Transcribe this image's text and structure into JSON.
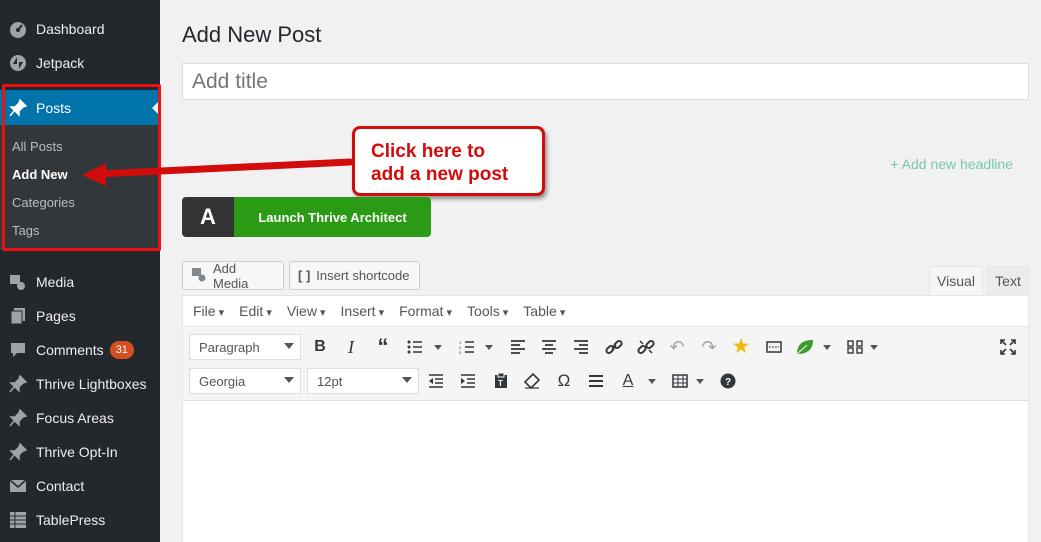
{
  "sidebar": {
    "items_top": [
      {
        "label": "Dashboard",
        "icon": "dashboard-icon"
      },
      {
        "label": "Jetpack",
        "icon": "jetpack-icon"
      }
    ],
    "posts": {
      "label": "Posts",
      "icon": "pin-icon"
    },
    "submenu": [
      {
        "label": "All Posts"
      },
      {
        "label": "Add New"
      },
      {
        "label": "Categories"
      },
      {
        "label": "Tags"
      }
    ],
    "items_bottom": [
      {
        "label": "Media",
        "icon": "media-icon"
      },
      {
        "label": "Pages",
        "icon": "pages-icon"
      },
      {
        "label": "Comments",
        "icon": "comments-icon",
        "badge": "31"
      },
      {
        "label": "Thrive Lightboxes",
        "icon": "pin-icon"
      },
      {
        "label": "Focus Areas",
        "icon": "pin-icon"
      },
      {
        "label": "Thrive Opt-In",
        "icon": "pin-icon"
      },
      {
        "label": "Contact",
        "icon": "mail-icon"
      },
      {
        "label": "TablePress",
        "icon": "table-icon"
      }
    ]
  },
  "main": {
    "page_title": "Add New Post",
    "title_placeholder": "Add title",
    "add_headline": "+ Add new headline",
    "callout_line1": "Click here to",
    "callout_line2": "add a new post",
    "thrive_logo": "A",
    "thrive_button": "Launch Thrive Architect",
    "add_media": "Add Media",
    "insert_shortcode": "Insert shortcode",
    "tab_visual": "Visual",
    "tab_text": "Text"
  },
  "editor": {
    "menus": [
      "File",
      "Edit",
      "View",
      "Insert",
      "Format",
      "Tools",
      "Table"
    ],
    "format_select": "Paragraph",
    "font_select": "Georgia",
    "size_select": "12pt"
  },
  "colors": {
    "sidebar_bg": "#23282d",
    "active_blue": "#0073aa",
    "callout_red": "#d20b0b",
    "thrive_green": "#2b9b16",
    "badge_orange": "#d54e21"
  }
}
